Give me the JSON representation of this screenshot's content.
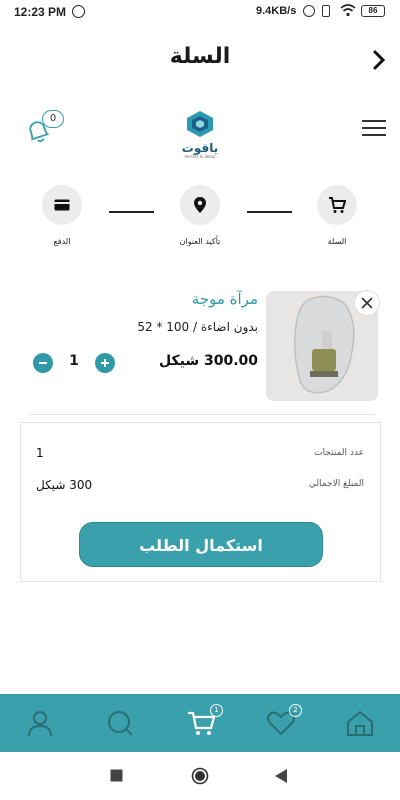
{
  "status": {
    "time": "12:23 PM",
    "speed": "9.4KB/s",
    "battery": "86"
  },
  "header": {
    "title": "السلة"
  },
  "notifications": {
    "count": "0"
  },
  "logo": {
    "name": "ياقوت",
    "tagline": "mirrors & decor"
  },
  "steps": [
    {
      "label": "السلة",
      "icon": "cart-icon"
    },
    {
      "label": "تأكيد العنوان",
      "icon": "location-pin-icon"
    },
    {
      "label": "الدفع",
      "icon": "credit-card-icon"
    }
  ],
  "cart_item": {
    "name": "مرآة موجة",
    "variant": "بدون اضاءة / 100 * 52",
    "price": "300.00 شيكل",
    "quantity": "1"
  },
  "summary": {
    "count_label": "عدد المنتجات",
    "count_value": "1",
    "total_label": "المبلغ الاجمالي",
    "total_value": "300 شيكل",
    "checkout_label": "استكمال الطلب"
  },
  "bottom_nav": {
    "cart_badge": "1",
    "favorites_badge": "2",
    "items": [
      "profile-icon",
      "search-icon",
      "cart-icon",
      "heart-icon",
      "home-icon"
    ]
  },
  "colors": {
    "accent": "#3aa0ab",
    "item_name": "#2f9aa6"
  }
}
